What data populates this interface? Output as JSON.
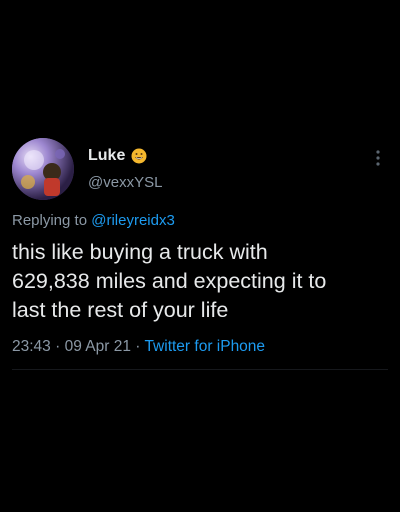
{
  "tweet": {
    "display_name": "Luke",
    "handle": "@vexxYSL",
    "reply_prefix": "Replying to ",
    "reply_to": "@rileyreidx3",
    "text_lines": [
      "this like buying a truck with",
      "629,838 miles and expecting it to",
      "last the rest of your life"
    ],
    "time": "23:43",
    "separator": " · ",
    "date": "09 Apr 21",
    "source": "Twitter for iPhone"
  },
  "icons": {
    "name_emoji": "grinning-face-emoji-icon",
    "more": "vertical-ellipsis-icon"
  },
  "colors": {
    "background": "#000000",
    "primary_text": "#e7e9ea",
    "secondary_text": "#8b98a5",
    "link": "#1d9bf0"
  }
}
